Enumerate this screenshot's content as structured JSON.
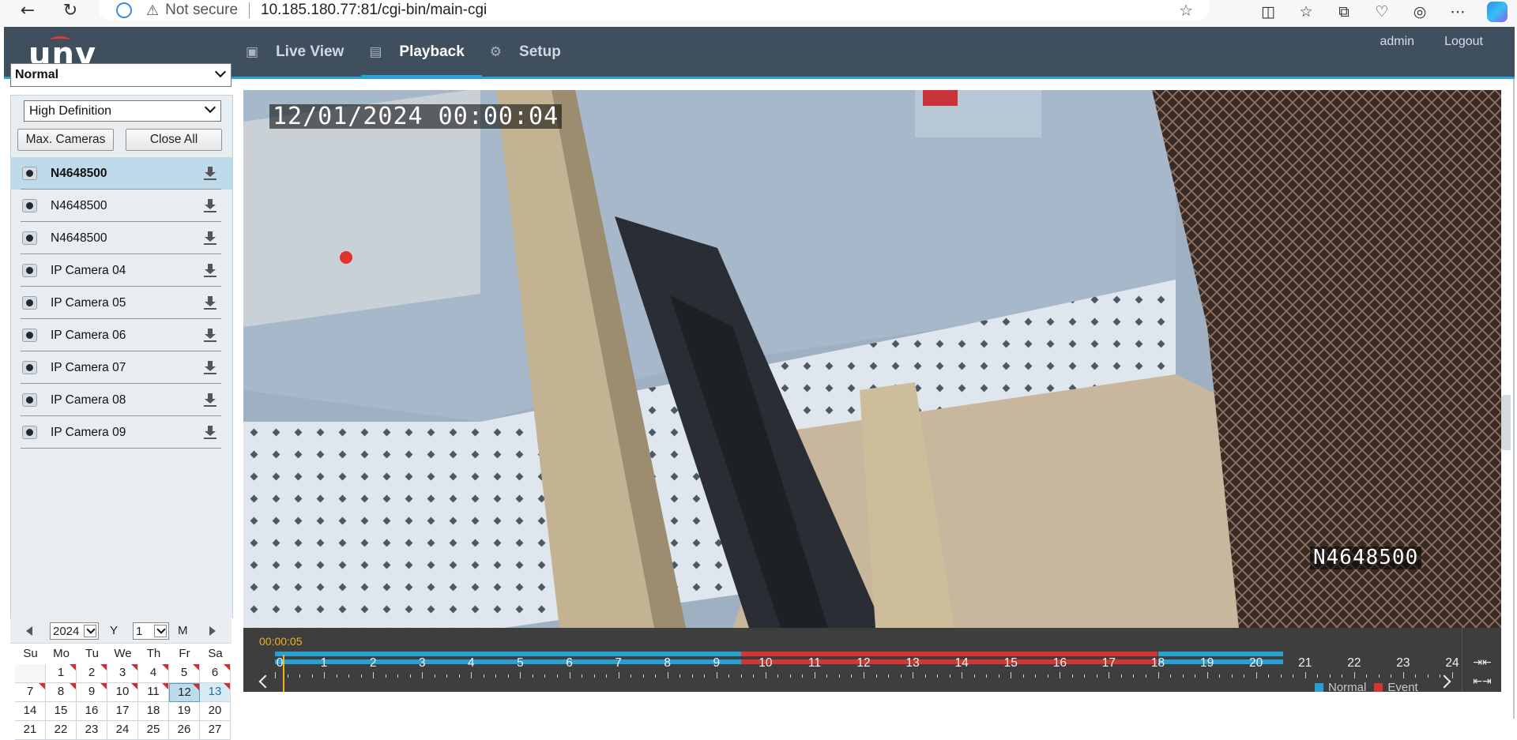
{
  "browser": {
    "not_secure": "Not secure",
    "url": "10.185.180.77:81/cgi-bin/main-cgi"
  },
  "header": {
    "logo": "UNV",
    "tabs": [
      {
        "label": "Live View",
        "icon": "monitor-icon"
      },
      {
        "label": "Playback",
        "icon": "playback-icon"
      },
      {
        "label": "Setup",
        "icon": "gear-icon"
      }
    ],
    "active_tab": "Playback",
    "user": "admin",
    "logout": "Logout"
  },
  "left_panel": {
    "mode": "Normal",
    "quality": "High Definition",
    "max_cameras_label": "Max. Cameras",
    "close_all_label": "Close All",
    "cameras": [
      {
        "name": "N4648500",
        "selected": true
      },
      {
        "name": "N4648500",
        "selected": false
      },
      {
        "name": "N4648500",
        "selected": false
      },
      {
        "name": "IP Camera 04",
        "selected": false
      },
      {
        "name": "IP Camera 05",
        "selected": false
      },
      {
        "name": "IP Camera 06",
        "selected": false
      },
      {
        "name": "IP Camera 07",
        "selected": false
      },
      {
        "name": "IP Camera 08",
        "selected": false
      },
      {
        "name": "IP Camera 09",
        "selected": false
      }
    ]
  },
  "calendar": {
    "year": "2024",
    "year_unit": "Y",
    "month": "1",
    "month_unit": "M",
    "weekdays": [
      "Su",
      "Mo",
      "Tu",
      "We",
      "Th",
      "Fr",
      "Sa"
    ],
    "days": [
      "",
      "1",
      "2",
      "3",
      "4",
      "5",
      "6",
      "7",
      "8",
      "9",
      "10",
      "11",
      "12",
      "13",
      "14",
      "15",
      "16",
      "17",
      "18",
      "19",
      "20",
      "21",
      "22",
      "23",
      "24",
      "25",
      "26",
      "27"
    ],
    "selected_day": "12",
    "today": "13",
    "days_with_records": [
      "1",
      "2",
      "3",
      "4",
      "5",
      "6",
      "7",
      "8",
      "9",
      "10",
      "11",
      "12",
      "13"
    ]
  },
  "video": {
    "timestamp": "12/01/2024 00:00:04",
    "camera_label": "N4648500"
  },
  "timeline": {
    "current_time": "00:00:05",
    "hours": [
      "0",
      "1",
      "2",
      "3",
      "4",
      "5",
      "6",
      "7",
      "8",
      "9",
      "10",
      "11",
      "12",
      "13",
      "14",
      "15",
      "16",
      "17",
      "18",
      "19",
      "20",
      "21",
      "22",
      "23",
      "24"
    ],
    "normal_segments": [
      [
        0,
        9.5
      ],
      [
        18.0,
        20.55
      ]
    ],
    "event_segments": [
      [
        9.5,
        18.0
      ]
    ],
    "legend_normal": "Normal",
    "legend_event": "Event",
    "colors": {
      "normal": "#27a0d4",
      "event": "#d33535",
      "cursor": "#f0b324"
    }
  }
}
